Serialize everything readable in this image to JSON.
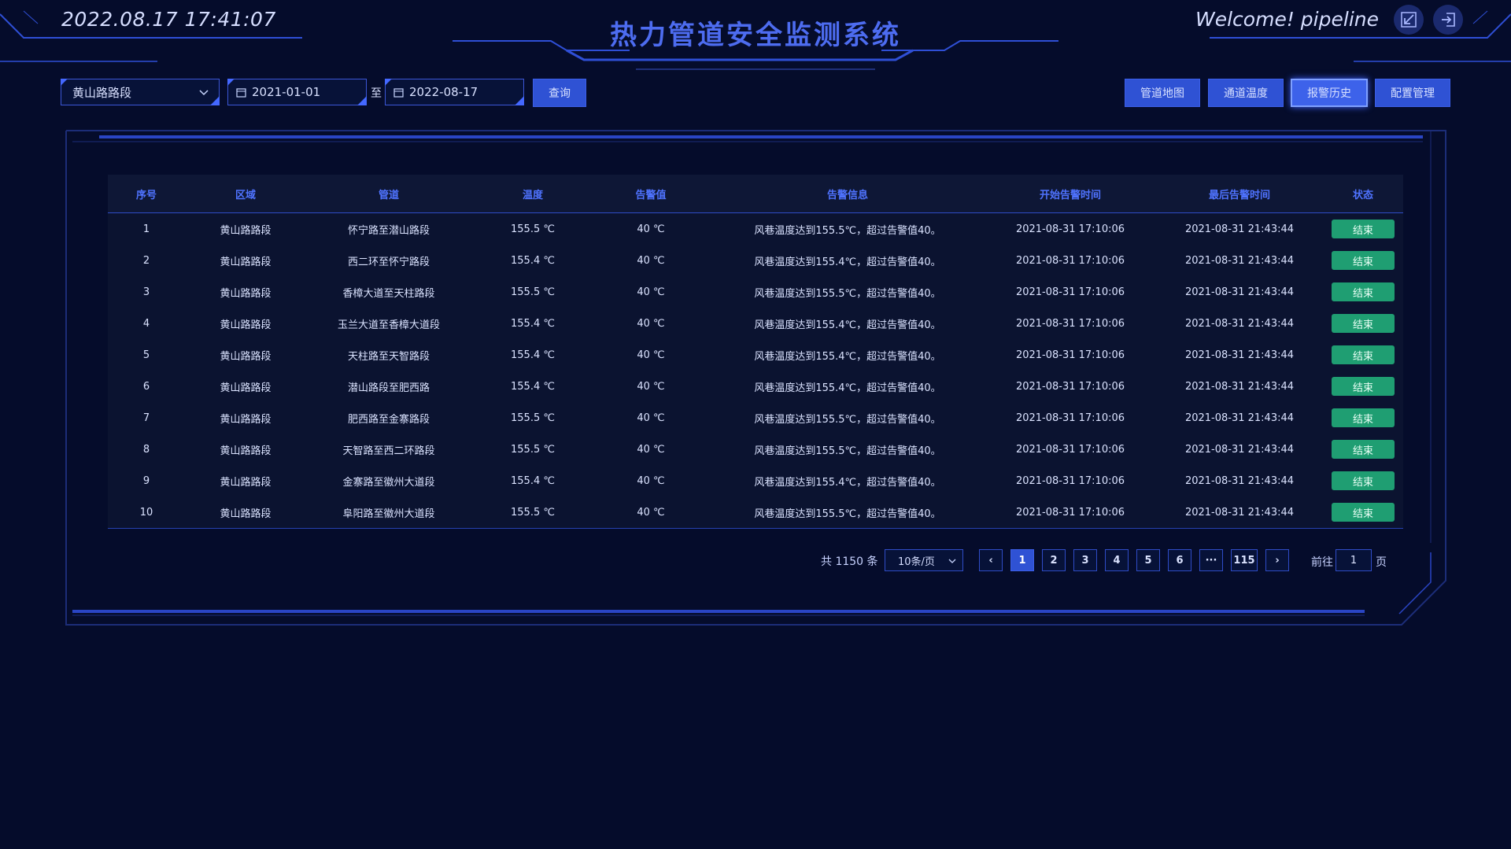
{
  "header": {
    "datetime": "2022.08.17 17:41:07",
    "title": "热力管道安全监测系统",
    "welcome": "Welcome! pipeline"
  },
  "filters": {
    "region_value": "黄山路路段",
    "start_date": "2021-01-01",
    "date_separator": "至",
    "end_date": "2022-08-17",
    "query_label": "查询"
  },
  "nav": {
    "buttons": [
      {
        "label": "管道地图",
        "active": false
      },
      {
        "label": "通道温度",
        "active": false
      },
      {
        "label": "报警历史",
        "active": true
      },
      {
        "label": "配置管理",
        "active": false
      }
    ]
  },
  "table": {
    "columns": [
      "序号",
      "区域",
      "管道",
      "温度",
      "告警值",
      "告警信息",
      "开始告警时间",
      "最后告警时间",
      "状态"
    ],
    "rows": [
      [
        "1",
        "黄山路路段",
        "怀宁路至潜山路段",
        "155.5 ℃",
        "40 ℃",
        "风巷温度达到155.5℃，超过告警值40。",
        "2021-08-31 17:10:06",
        "2021-08-31 21:43:44",
        "结束"
      ],
      [
        "2",
        "黄山路路段",
        "西二环至怀宁路段",
        "155.4 ℃",
        "40 ℃",
        "风巷温度达到155.4℃，超过告警值40。",
        "2021-08-31 17:10:06",
        "2021-08-31 21:43:44",
        "结束"
      ],
      [
        "3",
        "黄山路路段",
        "香樟大道至天柱路段",
        "155.5 ℃",
        "40 ℃",
        "风巷温度达到155.5℃，超过告警值40。",
        "2021-08-31 17:10:06",
        "2021-08-31 21:43:44",
        "结束"
      ],
      [
        "4",
        "黄山路路段",
        "玉兰大道至香樟大道段",
        "155.4 ℃",
        "40 ℃",
        "风巷温度达到155.4℃，超过告警值40。",
        "2021-08-31 17:10:06",
        "2021-08-31 21:43:44",
        "结束"
      ],
      [
        "5",
        "黄山路路段",
        "天柱路至天智路段",
        "155.4 ℃",
        "40 ℃",
        "风巷温度达到155.4℃，超过告警值40。",
        "2021-08-31 17:10:06",
        "2021-08-31 21:43:44",
        "结束"
      ],
      [
        "6",
        "黄山路路段",
        "潜山路段至肥西路",
        "155.4 ℃",
        "40 ℃",
        "风巷温度达到155.4℃，超过告警值40。",
        "2021-08-31 17:10:06",
        "2021-08-31 21:43:44",
        "结束"
      ],
      [
        "7",
        "黄山路路段",
        "肥西路至金寨路段",
        "155.5 ℃",
        "40 ℃",
        "风巷温度达到155.5℃，超过告警值40。",
        "2021-08-31 17:10:06",
        "2021-08-31 21:43:44",
        "结束"
      ],
      [
        "8",
        "黄山路路段",
        "天智路至西二环路段",
        "155.5 ℃",
        "40 ℃",
        "风巷温度达到155.5℃，超过告警值40。",
        "2021-08-31 17:10:06",
        "2021-08-31 21:43:44",
        "结束"
      ],
      [
        "9",
        "黄山路路段",
        "金寨路至徽州大道段",
        "155.4 ℃",
        "40 ℃",
        "风巷温度达到155.4℃，超过告警值40。",
        "2021-08-31 17:10:06",
        "2021-08-31 21:43:44",
        "结束"
      ],
      [
        "10",
        "黄山路路段",
        "阜阳路至徽州大道段",
        "155.5 ℃",
        "40 ℃",
        "风巷温度达到155.5℃，超过告警值40。",
        "2021-08-31 17:10:06",
        "2021-08-31 21:43:44",
        "结束"
      ]
    ]
  },
  "pagination": {
    "total": "共 1150 条",
    "page_size": "10条/页",
    "prev": "‹",
    "pages": [
      "1",
      "2",
      "3",
      "4",
      "5",
      "6",
      "···",
      "115"
    ],
    "current": "1",
    "next": "›",
    "goto_label": "前往",
    "goto_value": "1",
    "page_suffix": "页"
  },
  "colors": {
    "background": "#050c2b",
    "accent": "#2f52d4",
    "title": "#4d6cf0",
    "status_ok": "#1f9e72"
  }
}
